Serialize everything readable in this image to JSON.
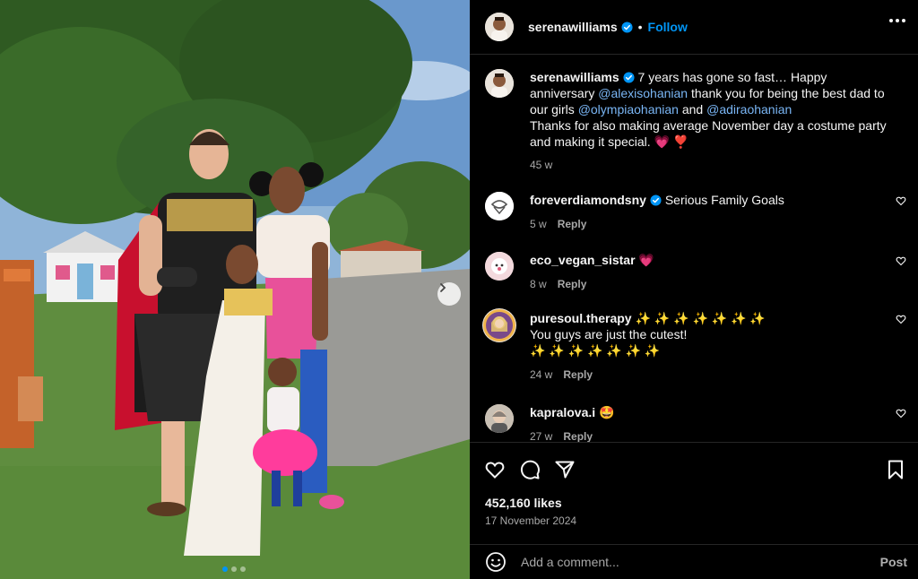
{
  "post": {
    "author": "serenawilliams",
    "follow_label": "Follow",
    "separator": "•",
    "caption_line1": "7 years has gone so fast… Happy anniversary",
    "mention1": "@alexisohanian",
    "caption_line2": "thank you for being the best dad to our girls",
    "mention2": "@olympiaohanian",
    "and_word": "and",
    "mention3": "@adiraohanian",
    "caption_line3": "Thanks for also making average November day a costume party and making it special. 💗 ❣️",
    "caption_time": "45 w",
    "likes": "452,160 likes",
    "date": "17 November 2024",
    "carousel_index": 1,
    "carousel_total": 3
  },
  "comments": [
    {
      "user": "foreverdiamondsny",
      "verified": true,
      "text": "Serious Family Goals",
      "time": "5 w",
      "reply": "Reply"
    },
    {
      "user": "eco_vegan_sistar",
      "verified": false,
      "text": "💗",
      "time": "8 w",
      "reply": "Reply"
    },
    {
      "user": "puresoul.therapy",
      "verified": false,
      "text": "✨ ✨ ✨ ✨ ✨ ✨ ✨",
      "text2": "You guys are just the cutest!",
      "text3": "✨ ✨ ✨ ✨ ✨ ✨ ✨",
      "time": "24 w",
      "reply": "Reply"
    },
    {
      "user": "kapralova.i",
      "verified": false,
      "text": "🤩",
      "time": "27 w",
      "reply": "Reply"
    }
  ],
  "add_comment": {
    "placeholder": "Add a comment...",
    "post_label": "Post"
  },
  "icons": {
    "like": "heart-icon",
    "comment": "comment-icon",
    "share": "share-icon",
    "save": "bookmark-icon",
    "emoji": "emoji-icon",
    "more": "more-icon"
  },
  "colors": {
    "background": "#000000",
    "link": "#0095f6",
    "muted": "#a8a8a8",
    "divider": "#262626"
  }
}
